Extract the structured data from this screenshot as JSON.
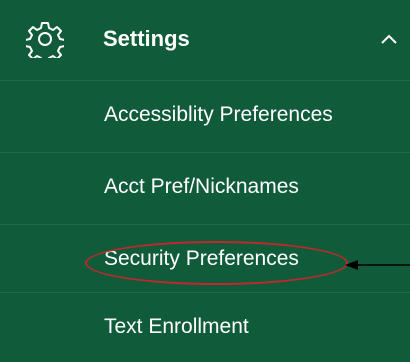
{
  "colors": {
    "menu_background": "#0f5b3a",
    "text": "#ffffff",
    "highlight_oval": "#c0282b",
    "arrow": "#000000"
  },
  "header": {
    "icon": "gear-icon",
    "label": "Settings",
    "toggle_icon": "chevron-up-icon"
  },
  "items": [
    {
      "label": "Accessiblity Preferences"
    },
    {
      "label": "Acct Pref/Nicknames"
    },
    {
      "label": "Security Preferences"
    },
    {
      "label": "Text Enrollment"
    }
  ]
}
